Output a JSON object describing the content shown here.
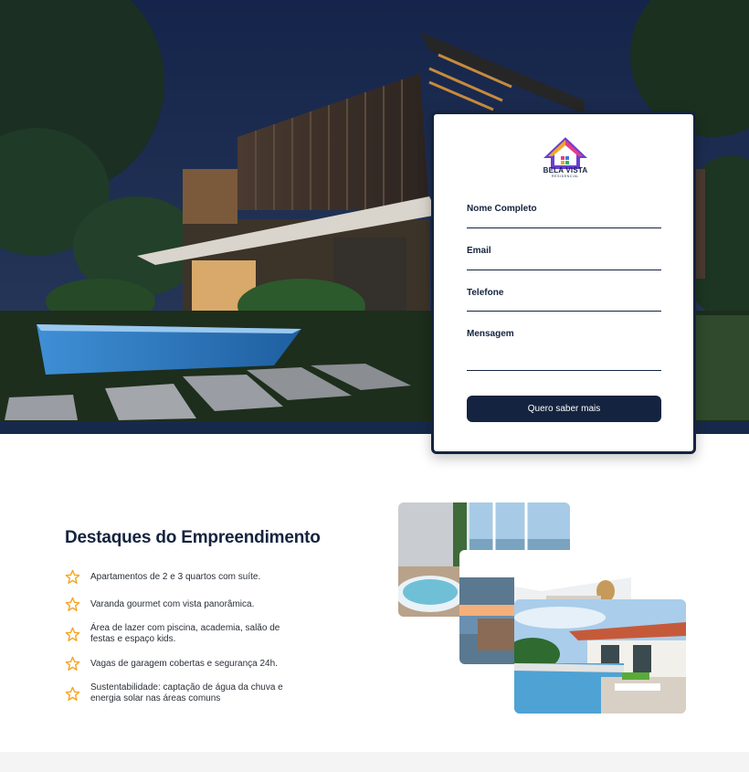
{
  "brand": {
    "name": "BELA VISTA",
    "subtitle": "RESIDENCIAL",
    "colors": {
      "navy": "#14233f",
      "accent_star": "#f5a623"
    }
  },
  "form": {
    "fields": [
      {
        "label": "Nome Completo"
      },
      {
        "label": "Email"
      },
      {
        "label": "Telefone"
      },
      {
        "label": "Mensagem"
      }
    ],
    "submit_label": "Quero saber mais"
  },
  "features": {
    "title": "Destaques do Empreendimento",
    "icon": "star-icon",
    "items": [
      "Apartamentos de 2 e 3 quartos com suíte.",
      "Varanda gourmet com vista panorâmica.",
      "Área de lazer com piscina, academia, salão de festas e espaço kids.",
      "Vagas de garagem cobertas e segurança 24h.",
      "Sustentabilidade: captação de água da chuva e energia solar nas áreas comuns"
    ]
  }
}
